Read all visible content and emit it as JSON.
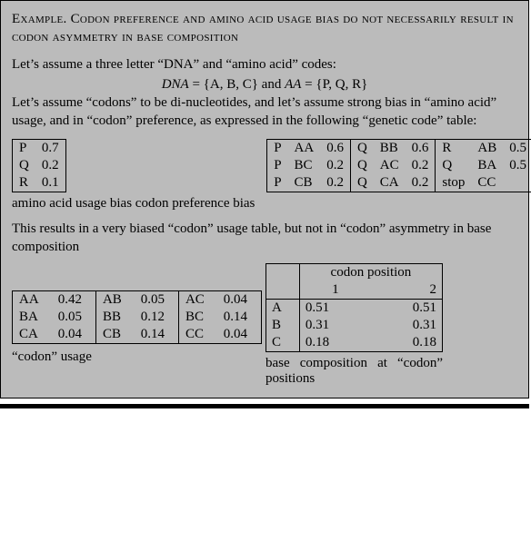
{
  "title": "Example. Codon preference and amino acid usage bias do not necessarily result in codon asymmetry in base composition",
  "para1": "Let’s assume a three letter “DNA” and “amino acid” codes:",
  "eqn": {
    "lhs1": "DNA",
    "set1": " = {A, B, C}",
    "and": "  and  ",
    "lhs2": "AA",
    "set2": " = {P, Q, R}"
  },
  "para2": "Let’s assume “codons” to be di-nucleotides, and let’s assume strong bias in “amino acid” usage, and in “codon” preference, as expressed in the following “genetic code” table:",
  "aa_bias": {
    "rows": [
      {
        "aa": "P",
        "v": "0.7"
      },
      {
        "aa": "Q",
        "v": "0.2"
      },
      {
        "aa": "R",
        "v": "0.1"
      }
    ],
    "caption": "amino acid usage bias"
  },
  "codon_pref": {
    "rows": [
      [
        "P",
        "AA",
        "0.6",
        "Q",
        "BB",
        "0.6",
        "R",
        "AB",
        "0.5"
      ],
      [
        "P",
        "BC",
        "0.2",
        "Q",
        "AC",
        "0.2",
        "Q",
        "BA",
        "0.5"
      ],
      [
        "P",
        "CB",
        "0.2",
        "Q",
        "CA",
        "0.2",
        "stop",
        "CC",
        ""
      ]
    ],
    "caption": "codon preference bias"
  },
  "para3": "This results in a very biased “codon” usage table, but not in “codon” asymmetry in base composition",
  "codon_usage": {
    "rows": [
      [
        "AA",
        "0.42",
        "AB",
        "0.05",
        "AC",
        "0.04"
      ],
      [
        "BA",
        "0.05",
        "BB",
        "0.12",
        "BC",
        "0.14"
      ],
      [
        "CA",
        "0.04",
        "CB",
        "0.14",
        "CC",
        "0.04"
      ]
    ],
    "caption": "“codon” usage"
  },
  "base_comp": {
    "header": "codon position",
    "cols": [
      "1",
      "2"
    ],
    "rows": [
      {
        "b": "A",
        "c1": "0.51",
        "c2": "0.51"
      },
      {
        "b": "B",
        "c1": "0.31",
        "c2": "0.31"
      },
      {
        "b": "C",
        "c1": "0.18",
        "c2": "0.18"
      }
    ],
    "caption": "base composition at “codon” positions"
  }
}
